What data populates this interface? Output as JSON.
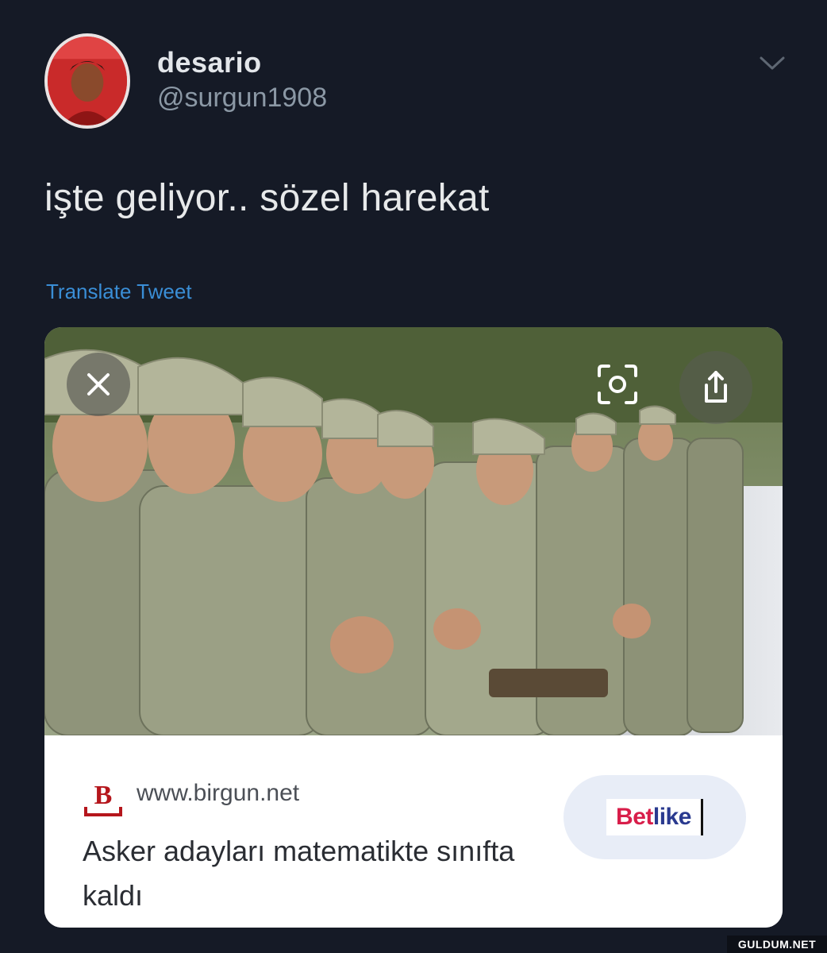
{
  "tweet": {
    "display_name": "desario",
    "handle": "@surgun1908",
    "text": "işte geliyor.. sözel harekat",
    "translate_label": "Translate Tweet"
  },
  "card": {
    "domain": "www.birgun.net",
    "headline": "Asker adayları matematikte sınıfta kaldı",
    "source_logo_letter": "B",
    "ad_logo_part1": "Bet",
    "ad_logo_part2": "like"
  },
  "icons": {
    "caret": "chevron-down-icon",
    "close": "close-icon",
    "lens": "visual-search-icon",
    "share": "share-icon"
  },
  "colors": {
    "background": "#151a26",
    "link_blue": "#3a8ed6",
    "brand_red": "#b5161c",
    "ad_red": "#d81e4a",
    "ad_blue": "#2a3a8f"
  },
  "watermark": "GULDUM.NET"
}
